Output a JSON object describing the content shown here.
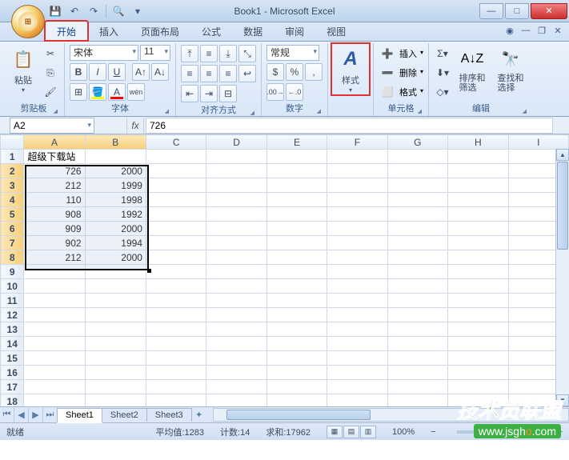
{
  "title": "Book1 - Microsoft Excel",
  "tabs": [
    "开始",
    "插入",
    "页面布局",
    "公式",
    "数据",
    "审阅",
    "视图"
  ],
  "active_tab": 0,
  "ribbon": {
    "clipboard": {
      "label": "剪贴板",
      "paste": "粘贴"
    },
    "font": {
      "label": "字体",
      "name": "宋体",
      "size": "11"
    },
    "align": {
      "label": "对齐方式"
    },
    "number": {
      "label": "数字",
      "format": "常规"
    },
    "styles": {
      "label": "样式",
      "btn": "样式"
    },
    "cells": {
      "label": "单元格",
      "insert": "插入",
      "delete": "删除",
      "format": "格式"
    },
    "editing": {
      "label": "编辑",
      "sort": "排序和\n筛选",
      "find": "查找和\n选择"
    }
  },
  "namebox": "A2",
  "formula": "726",
  "columns": [
    "A",
    "B",
    "C",
    "D",
    "E",
    "F",
    "G",
    "H",
    "I"
  ],
  "row_count": 18,
  "selected_rows": [
    2,
    3,
    4,
    5,
    6,
    7,
    8
  ],
  "selected_cols": [
    "A",
    "B"
  ],
  "cells": {
    "A1": "超级下载站",
    "A2": "726",
    "B2": "2000",
    "A3": "212",
    "B3": "1999",
    "A4": "110",
    "B4": "1998",
    "A5": "908",
    "B5": "1992",
    "A6": "909",
    "B6": "2000",
    "A7": "902",
    "B7": "1994",
    "A8": "212",
    "B8": "2000"
  },
  "sheets": [
    "Sheet1",
    "Sheet2",
    "Sheet3"
  ],
  "active_sheet": 0,
  "status": {
    "mode": "就绪",
    "avg_label": "平均值:",
    "avg": "1283",
    "count_label": "计数:",
    "count": "14",
    "sum_label": "求和:",
    "sum": "17962",
    "zoom": "100%"
  },
  "watermark": {
    "line1": "技术员联盟",
    "line2_a": "www.jsgh",
    "line2_b": "o",
    "line2_c": ".com"
  }
}
